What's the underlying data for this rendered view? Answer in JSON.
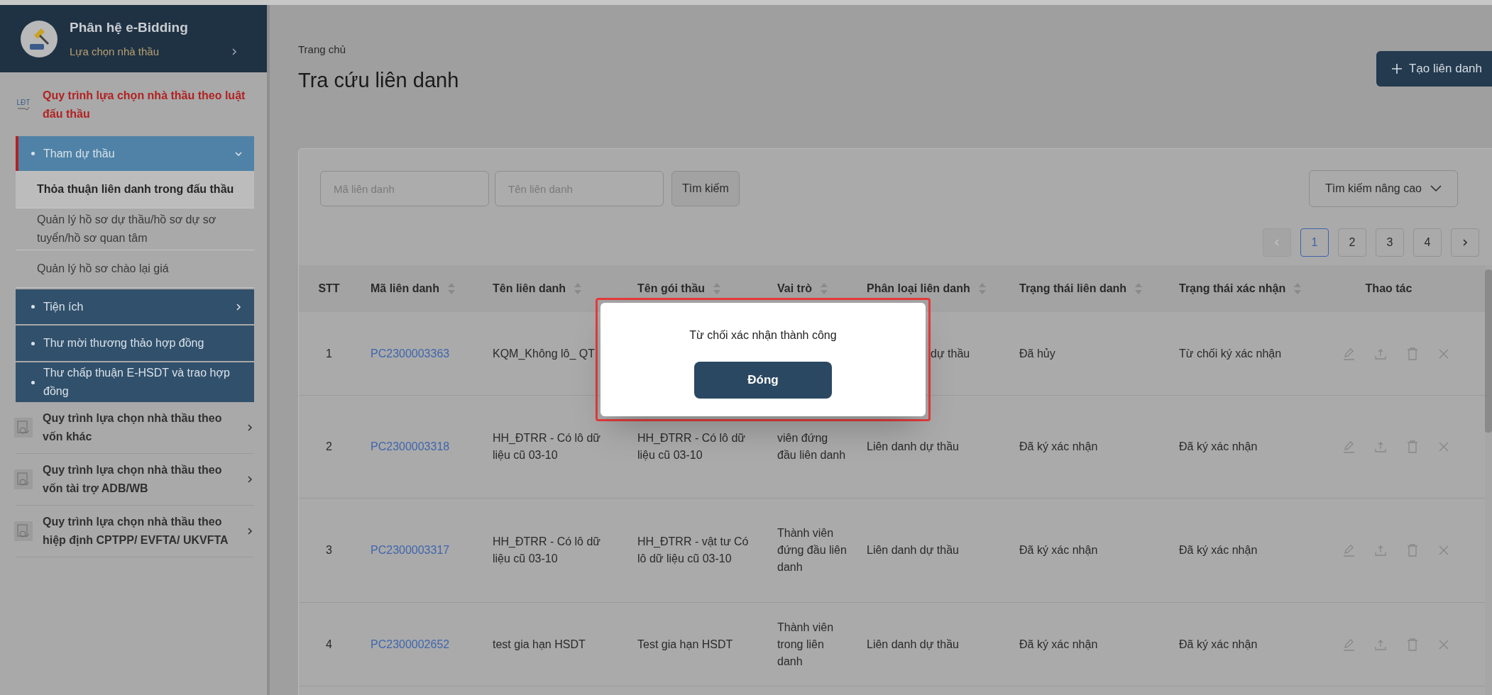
{
  "sidebar": {
    "header": {
      "title": "Phân hệ e-Bidding",
      "subtitle": "Lựa chọn nhà thầu"
    },
    "menu": [
      {
        "kind": "process",
        "label": "Quy trình lựa chọn nhà thầu theo luật đấu thầu",
        "active": true,
        "icon_text": "LĐT",
        "has_arrow": false
      },
      {
        "kind": "group",
        "label": "Tham dự thầu",
        "expanded": true,
        "children": [
          {
            "label": "Thỏa thuận liên danh trong đấu thầu",
            "selected": true
          },
          {
            "label": "Quản lý hồ sơ dự thầu/hồ sơ dự sơ tuyển/hồ sơ quan tâm",
            "selected": false
          },
          {
            "label": "Quản lý hồ sơ chào lại giá",
            "selected": false
          }
        ]
      },
      {
        "kind": "group",
        "label": "Tiện ích",
        "expanded": false
      },
      {
        "kind": "link",
        "label": "Thư mời thương thảo hợp đồng"
      },
      {
        "kind": "link",
        "label": "Thư chấp thuận E-HSDT và trao hợp đồng"
      },
      {
        "kind": "process",
        "label": "Quy trình lựa chọn nhà thầu theo vốn khác",
        "active": false,
        "has_arrow": true
      },
      {
        "kind": "process",
        "label": "Quy trình lựa chọn nhà thầu theo vốn tài trợ ADB/WB",
        "active": false,
        "has_arrow": true
      },
      {
        "kind": "process",
        "label": "Quy trình lựa chọn nhà thầu theo hiệp định CPTPP/ EVFTA/ UKVFTA",
        "active": false,
        "has_arrow": true
      }
    ]
  },
  "breadcrumb": "Trang chủ",
  "page_title": "Tra cứu liên danh",
  "create_button": "Tạo liên danh",
  "search": {
    "fields": [
      {
        "placeholder": "Mã liên danh"
      },
      {
        "placeholder": "Tên liên danh"
      }
    ],
    "button": "Tìm kiếm",
    "advanced": "Tìm kiếm nâng cao"
  },
  "pagination": [
    {
      "kind": "prev",
      "disabled": true
    },
    {
      "label": "1",
      "selected": true
    },
    {
      "label": "2",
      "selected": false
    },
    {
      "label": "3",
      "selected": false
    },
    {
      "label": "4",
      "selected": false
    },
    {
      "kind": "next",
      "disabled": false
    }
  ],
  "table": {
    "columns": [
      {
        "label": "STT",
        "sortable": false
      },
      {
        "label": "Mã liên danh",
        "sortable": true
      },
      {
        "label": "Tên liên danh",
        "sortable": true
      },
      {
        "label": "Tên gói thầu",
        "sortable": true
      },
      {
        "label": "Vai trò",
        "sortable": true
      },
      {
        "label": "Phân loại liên danh",
        "sortable": true
      },
      {
        "label": "Trạng thái liên danh",
        "sortable": true
      },
      {
        "label": "Trạng thái xác nhận",
        "sortable": true
      },
      {
        "label": "Thao tác",
        "sortable": false
      }
    ],
    "rows": [
      {
        "stt": "1",
        "code": "PC2300003363",
        "name": "KQM_Không lô_ QT",
        "package": "",
        "role": "",
        "type": "dự thầu",
        "status": "Đã hủy",
        "confirm": "Từ chối ký xác nhận"
      },
      {
        "stt": "2",
        "code": "PC2300003318",
        "name": "HH_ĐTRR - Có lô dữ liệu cũ 03-10",
        "package": "HH_ĐTRR - Có lô dữ liệu cũ 03-10",
        "role": "viên đứng đầu liên danh",
        "type": "Liên danh dự thầu",
        "status": "Đã ký xác nhận",
        "confirm": "Đã ký xác nhận"
      },
      {
        "stt": "3",
        "code": "PC2300003317",
        "name": "HH_ĐTRR - Có lô dữ liệu cũ 03-10",
        "package": "HH_ĐTRR - vật tư Có lô dữ liệu cũ 03-10",
        "role": "Thành viên đứng đầu liên danh",
        "type": "Liên danh dự thầu",
        "status": "Đã ký xác nhận",
        "confirm": "Đã ký xác nhận"
      },
      {
        "stt": "4",
        "code": "PC2300002652",
        "name": "test gia hạn HSDT",
        "package": "Test gia hạn HSDT",
        "role": "Thành viên trong liên danh",
        "type": "Liên danh dự thầu",
        "status": "Đã ký xác nhận",
        "confirm": "Đã ký xác nhận"
      }
    ]
  },
  "dialog": {
    "message": "Từ chối xác nhận thành công",
    "button": "Đóng"
  }
}
